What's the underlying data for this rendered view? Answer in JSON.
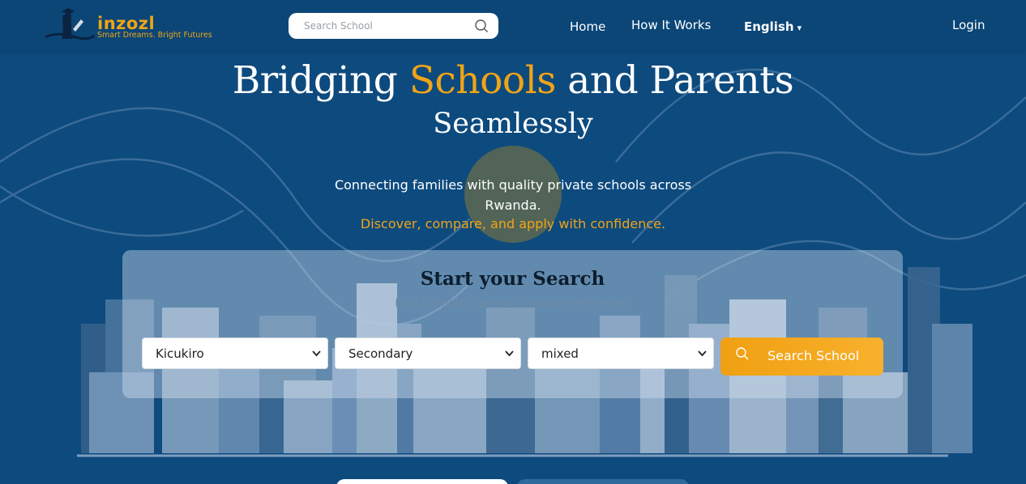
{
  "brand": {
    "name": "inzozl",
    "tagline": "Smart Dreams. Bright Futures",
    "accent_color": "#f0a417",
    "background_color": "#0d4a7e"
  },
  "header": {
    "search_placeholder": "Search School",
    "nav": {
      "home": "Home",
      "how_it_works": "How It Works",
      "language": "English",
      "login": "Login"
    }
  },
  "hero": {
    "title_before": "Bridging ",
    "title_highlight": "Schools",
    "title_after": " and Parents",
    "subtitle": "Seamlessly",
    "description_line1": "Connecting families with quality private schools across",
    "description_line2": "Rwanda.",
    "description_accent": "Discover, compare, and apply with confidence."
  },
  "search_card": {
    "title": "Start your Search",
    "subtitle": "Find schools that match your preferences",
    "district_value": "Kicukiro",
    "level_value": "Secondary",
    "gender_value": "mixed",
    "button_label": "Search School"
  },
  "icons": {
    "header_search": "search-icon",
    "search_button": "search-icon",
    "language_caret": "caret-down-icon",
    "select_chevron": "chevron-down-icon"
  }
}
